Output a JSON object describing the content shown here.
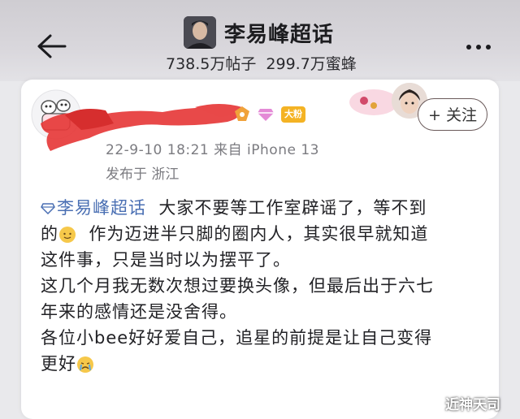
{
  "header": {
    "title": "李易峰超话",
    "posts_count": "738.5万帖子",
    "followers_count": "299.7万蜜蜂"
  },
  "post": {
    "time_source": "22-9-10 18:21 来自 iPhone 13",
    "location": "发布于 浙江",
    "badge_label": "大粉",
    "follow_label": "+ 关注",
    "topic_tag": "李易峰超话",
    "lines": [
      "大家不要等工作室辟谣了，等不到",
      "的",
      "作为迈进半只脚的圈内人，其实很早就知道",
      "这件事，只是当时以为摆平了。",
      "这几个月我无数次想过要换头像，但最后出于六七",
      "年来的感情还是没舍得。",
      "各位小bee好好爱自己，追星的前提是让自己变得",
      "更好"
    ]
  },
  "watermark": "近神天司",
  "colors": {
    "topic_link": "#4a6fb3",
    "redaction": "#e63a3a",
    "badge": "#f4b324"
  }
}
